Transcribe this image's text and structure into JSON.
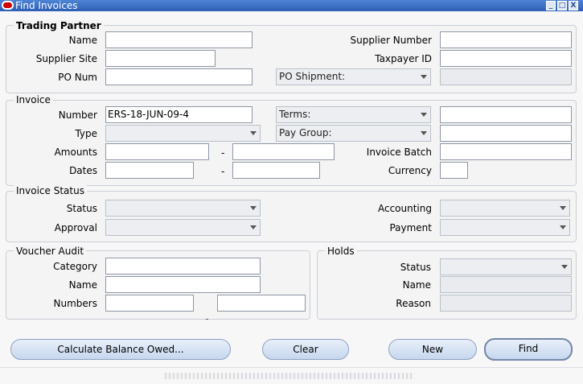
{
  "window": {
    "title": "Find Invoices",
    "controls": [
      "_",
      "□",
      "X"
    ]
  },
  "trading_partner": {
    "legend": "Trading Partner",
    "name_label": "Name",
    "name_value": "",
    "supplier_number_label": "Supplier Number",
    "supplier_number_value": "",
    "supplier_site_label": "Supplier Site",
    "supplier_site_value": "",
    "taxpayer_id_label": "Taxpayer ID",
    "taxpayer_id_value": "",
    "po_num_label": "PO Num",
    "po_num_value": "",
    "po_shipment_label": "PO Shipment:",
    "po_shipment_value": ""
  },
  "invoice": {
    "legend": "Invoice",
    "number_label": "Number",
    "number_value": "ERS-18-JUN-09-4",
    "terms_label": "Terms:",
    "terms_value": "",
    "type_label": "Type",
    "type_value": "",
    "pay_group_label": "Pay Group:",
    "pay_group_value": "",
    "amounts_label": "Amounts",
    "amount_from": "",
    "amount_to": "",
    "range_separator": "-",
    "invoice_batch_label": "Invoice Batch",
    "invoice_batch_value": "",
    "dates_label": "Dates",
    "date_from": "",
    "date_to": "",
    "currency_label": "Currency",
    "currency_value": ""
  },
  "invoice_status": {
    "legend": "Invoice Status",
    "status_label": "Status",
    "status_value": "",
    "accounting_label": "Accounting",
    "accounting_value": "",
    "approval_label": "Approval",
    "approval_value": "",
    "payment_label": "Payment",
    "payment_value": ""
  },
  "voucher_audit": {
    "legend": "Voucher Audit",
    "category_label": "Category",
    "category_value": "",
    "name_label": "Name",
    "name_value": "",
    "numbers_label": "Numbers",
    "numbers_from": "",
    "numbers_to": ""
  },
  "holds": {
    "legend": "Holds",
    "status_label": "Status",
    "status_value": "",
    "name_label": "Name",
    "name_value": "",
    "reason_label": "Reason",
    "reason_value": ""
  },
  "buttons": {
    "calculate_balance": "Calculate Balance Owed...",
    "clear": "Clear",
    "new": "New",
    "find": "Find"
  }
}
